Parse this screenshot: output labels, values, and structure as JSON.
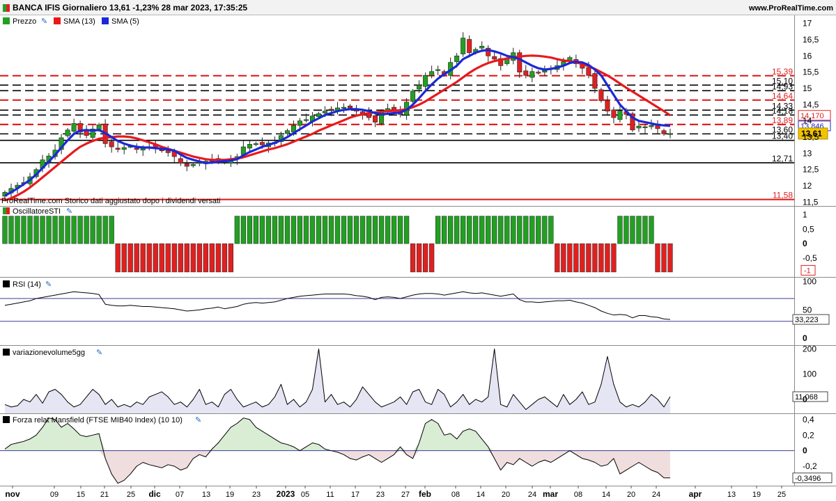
{
  "header": {
    "title": "BANCA IFIS Giornaliero 13,61 -1,23% 28 mar 2023, 17:35:25",
    "site": "www.ProRealTime.com",
    "note": "ProRealTime.com Storico dati aggiustato dopo i dividendi versati"
  },
  "colors": {
    "bull": "#22a022",
    "bear": "#e02020",
    "sma13": "#e8191c",
    "sma5": "#1a28d8",
    "panel_fill": "#e5e5f4",
    "pos_fill": "#d9ecd4",
    "neg_fill": "#f0dede"
  },
  "price_panel": {
    "legend": [
      "Prezzo",
      "SMA (13)",
      "SMA (5)"
    ],
    "yticks": [
      "17",
      "16,5",
      "16",
      "15,5",
      "15",
      "14,5",
      "14",
      "13,5",
      "13",
      "12,5",
      "12",
      "11,5"
    ],
    "levels": [
      {
        "value": "15,39",
        "num": 15.39,
        "color": "red",
        "style": "dashed"
      },
      {
        "value": "15,10",
        "num": 15.1,
        "color": "black",
        "style": "dashed"
      },
      {
        "value": "14,93",
        "num": 14.93,
        "color": "black",
        "style": "dashed"
      },
      {
        "value": "14,64",
        "num": 14.64,
        "color": "red",
        "style": "dashed"
      },
      {
        "value": "14,33",
        "num": 14.33,
        "color": "black",
        "style": "dashed"
      },
      {
        "value": "14,18",
        "num": 14.18,
        "color": "black",
        "style": "dashed"
      },
      {
        "value": "13,89",
        "num": 13.89,
        "color": "red",
        "style": "dashed"
      },
      {
        "value": "13,60",
        "num": 13.6,
        "color": "black",
        "style": "dashed"
      },
      {
        "value": "13,40",
        "num": 13.4,
        "color": "black",
        "style": "solid"
      },
      {
        "value": "12,71",
        "num": 12.71,
        "color": "black",
        "style": "solid"
      },
      {
        "value": "11,58",
        "num": 11.58,
        "color": "red",
        "style": "solid"
      }
    ],
    "tags": [
      {
        "value": "14,170",
        "num": 14.17,
        "color": "#e02020",
        "style": "box"
      },
      {
        "value": "13,846",
        "num": 13.846,
        "color": "#1a28d8",
        "style": "box"
      },
      {
        "value": "13,61",
        "num": 13.61,
        "color": "#000",
        "style": "gold"
      }
    ]
  },
  "sti_panel": {
    "title": "OscillatoreSTI",
    "yticks": [
      "1",
      "0,5",
      "0",
      "-0,5"
    ],
    "tag": "-1"
  },
  "rsi_panel": {
    "title": "RSI (14)",
    "yticks": [
      "100",
      "50",
      "0"
    ],
    "tag": "33,223"
  },
  "vol_panel": {
    "title": "variazionevolume5gg",
    "yticks": [
      "200",
      "100",
      "0"
    ],
    "tag": "11,068"
  },
  "mans_panel": {
    "title": "Forza relat Mansfield (FTSE MIB40 Index) (10 10)",
    "yticks": [
      "0,4",
      "0,2",
      "0",
      "-0,2"
    ],
    "tag": "-0,3496"
  },
  "xaxis": [
    {
      "label": "nov",
      "bold": true
    },
    {
      "label": "09"
    },
    {
      "label": "15"
    },
    {
      "label": "21"
    },
    {
      "label": "25"
    },
    {
      "label": "dic",
      "bold": true
    },
    {
      "label": "07"
    },
    {
      "label": "13"
    },
    {
      "label": "19"
    },
    {
      "label": "23"
    },
    {
      "label": "2023",
      "bold": true
    },
    {
      "label": "05"
    },
    {
      "label": "11"
    },
    {
      "label": "17"
    },
    {
      "label": "23"
    },
    {
      "label": "27"
    },
    {
      "label": "feb",
      "bold": true
    },
    {
      "label": "08"
    },
    {
      "label": "14"
    },
    {
      "label": "20"
    },
    {
      "label": "24"
    },
    {
      "label": "mar",
      "bold": true
    },
    {
      "label": "08"
    },
    {
      "label": "14"
    },
    {
      "label": "20"
    },
    {
      "label": "24"
    },
    {
      "label": "apr",
      "bold": true
    },
    {
      "label": "13"
    },
    {
      "label": "19"
    },
    {
      "label": "25"
    }
  ],
  "chart_data": {
    "type": "candlestick",
    "title": "BANCA IFIS Giornaliero",
    "x_dates": [
      "2022-10-28",
      "2022-10-31",
      "2022-11-01",
      "2022-11-02",
      "2022-11-03",
      "2022-11-04",
      "2022-11-07",
      "2022-11-08",
      "2022-11-09",
      "2022-11-10",
      "2022-11-11",
      "2022-11-14",
      "2022-11-15",
      "2022-11-16",
      "2022-11-17",
      "2022-11-18",
      "2022-11-21",
      "2022-11-22",
      "2022-11-23",
      "2022-11-24",
      "2022-11-25",
      "2022-11-28",
      "2022-11-29",
      "2022-11-30",
      "2022-12-01",
      "2022-12-02",
      "2022-12-05",
      "2022-12-06",
      "2022-12-07",
      "2022-12-08",
      "2022-12-09",
      "2022-12-12",
      "2022-12-13",
      "2022-12-14",
      "2022-12-15",
      "2022-12-16",
      "2022-12-19",
      "2022-12-20",
      "2022-12-21",
      "2022-12-22",
      "2022-12-23",
      "2022-12-27",
      "2022-12-28",
      "2022-12-29",
      "2022-12-30",
      "2023-01-02",
      "2023-01-03",
      "2023-01-04",
      "2023-01-05",
      "2023-01-06",
      "2023-01-09",
      "2023-01-10",
      "2023-01-11",
      "2023-01-12",
      "2023-01-13",
      "2023-01-16",
      "2023-01-17",
      "2023-01-18",
      "2023-01-19",
      "2023-01-20",
      "2023-01-23",
      "2023-01-24",
      "2023-01-25",
      "2023-01-26",
      "2023-01-27",
      "2023-01-30",
      "2023-01-31",
      "2023-02-01",
      "2023-02-02",
      "2023-02-03",
      "2023-02-06",
      "2023-02-07",
      "2023-02-08",
      "2023-02-09",
      "2023-02-10",
      "2023-02-13",
      "2023-02-14",
      "2023-02-15",
      "2023-02-16",
      "2023-02-17",
      "2023-02-20",
      "2023-02-21",
      "2023-02-22",
      "2023-02-23",
      "2023-02-24",
      "2023-02-27",
      "2023-02-28",
      "2023-03-01",
      "2023-03-02",
      "2023-03-03",
      "2023-03-06",
      "2023-03-07",
      "2023-03-08",
      "2023-03-09",
      "2023-03-10",
      "2023-03-13",
      "2023-03-14",
      "2023-03-15",
      "2023-03-16",
      "2023-03-17",
      "2023-03-20",
      "2023-03-21",
      "2023-03-22",
      "2023-03-23",
      "2023-03-24",
      "2023-03-27",
      "2023-03-28"
    ],
    "close": [
      11.8,
      11.92,
      12.02,
      12.1,
      12.28,
      12.5,
      12.8,
      12.92,
      13.1,
      13.48,
      13.72,
      13.92,
      13.65,
      13.55,
      13.75,
      13.88,
      13.3,
      13.2,
      13.12,
      13.18,
      13.22,
      13.12,
      13.16,
      13.2,
      13.15,
      13.08,
      13.02,
      12.9,
      12.7,
      12.6,
      12.66,
      12.72,
      12.76,
      12.8,
      12.82,
      12.72,
      12.8,
      12.9,
      13.2,
      13.28,
      13.3,
      13.26,
      13.32,
      13.34,
      13.55,
      13.7,
      13.86,
      14.0,
      14.04,
      14.15,
      14.22,
      14.3,
      14.33,
      14.4,
      14.42,
      14.4,
      14.3,
      14.22,
      14.1,
      13.96,
      14.3,
      14.38,
      14.34,
      14.2,
      14.58,
      14.92,
      15.1,
      15.4,
      15.52,
      15.58,
      15.42,
      15.8,
      16.0,
      16.55,
      16.1,
      16.2,
      16.3,
      16.0,
      15.9,
      15.7,
      15.9,
      16.1,
      15.5,
      15.4,
      15.52,
      15.48,
      15.55,
      15.62,
      15.7,
      15.82,
      15.95,
      15.76,
      15.62,
      15.4,
      15.0,
      14.62,
      14.3,
      14.1,
      14.3,
      14.2,
      13.72,
      13.84,
      13.82,
      13.86,
      13.76,
      13.6,
      13.61
    ],
    "sma13": [
      11.55,
      11.62,
      11.71,
      11.82,
      11.95,
      12.1,
      12.26,
      12.42,
      12.58,
      12.74,
      12.9,
      13.06,
      13.2,
      13.3,
      13.38,
      13.45,
      13.48,
      13.5,
      13.52,
      13.52,
      13.5,
      13.46,
      13.4,
      13.34,
      13.28,
      13.2,
      13.14,
      13.08,
      13.02,
      12.96,
      12.9,
      12.86,
      12.82,
      12.8,
      12.8,
      12.8,
      12.82,
      12.84,
      12.88,
      12.94,
      13.0,
      13.06,
      13.12,
      13.16,
      13.22,
      13.28,
      13.36,
      13.44,
      13.52,
      13.6,
      13.7,
      13.78,
      13.86,
      13.94,
      14.02,
      14.1,
      14.16,
      14.2,
      14.24,
      14.26,
      14.28,
      14.3,
      14.31,
      14.33,
      14.36,
      14.42,
      14.5,
      14.6,
      14.72,
      14.84,
      14.96,
      15.08,
      15.2,
      15.34,
      15.48,
      15.6,
      15.7,
      15.78,
      15.84,
      15.88,
      15.92,
      15.96,
      15.98,
      16.0,
      16.01,
      16.0,
      15.98,
      15.95,
      15.9,
      15.86,
      15.84,
      15.8,
      15.75,
      15.68,
      15.6,
      15.5,
      15.4,
      15.28,
      15.15,
      15.02,
      14.9,
      14.78,
      14.66,
      14.54,
      14.42,
      14.3,
      14.17
    ],
    "sma5": [
      11.7,
      11.8,
      11.92,
      12.05,
      12.18,
      12.35,
      12.55,
      12.75,
      12.95,
      13.18,
      13.4,
      13.6,
      13.7,
      13.72,
      13.7,
      13.72,
      13.62,
      13.5,
      13.38,
      13.3,
      13.24,
      13.2,
      13.18,
      13.18,
      13.16,
      13.14,
      13.12,
      13.08,
      12.96,
      12.86,
      12.8,
      12.75,
      12.7,
      12.72,
      12.74,
      12.76,
      12.78,
      12.82,
      12.94,
      13.04,
      13.12,
      13.2,
      13.26,
      13.32,
      13.4,
      13.5,
      13.62,
      13.74,
      13.86,
      13.98,
      14.08,
      14.18,
      14.24,
      14.3,
      14.34,
      14.36,
      14.36,
      14.34,
      14.3,
      14.24,
      14.2,
      14.22,
      14.24,
      14.26,
      14.34,
      14.5,
      14.7,
      14.92,
      15.12,
      15.3,
      15.44,
      15.56,
      15.7,
      15.9,
      16.0,
      16.1,
      16.16,
      16.18,
      16.14,
      16.08,
      16.0,
      15.96,
      15.9,
      15.8,
      15.7,
      15.62,
      15.58,
      15.6,
      15.64,
      15.7,
      15.78,
      15.82,
      15.8,
      15.72,
      15.58,
      15.4,
      15.1,
      14.8,
      14.5,
      14.3,
      14.1,
      14.0,
      13.96,
      13.92,
      13.88,
      13.86,
      13.846
    ],
    "sti": [
      1,
      1,
      1,
      1,
      1,
      1,
      1,
      1,
      1,
      1,
      1,
      1,
      1,
      1,
      1,
      1,
      1,
      1,
      -1,
      -1,
      -1,
      -1,
      -1,
      -1,
      -1,
      -1,
      -1,
      -1,
      -1,
      -1,
      -1,
      -1,
      -1,
      -1,
      -1,
      -1,
      -1,
      1,
      1,
      1,
      1,
      1,
      1,
      1,
      1,
      1,
      1,
      1,
      1,
      1,
      1,
      1,
      1,
      1,
      1,
      1,
      1,
      1,
      1,
      1,
      1,
      1,
      1,
      1,
      1,
      -1,
      -1,
      -1,
      -1,
      1,
      1,
      1,
      1,
      1,
      1,
      1,
      1,
      1,
      1,
      1,
      1,
      1,
      1,
      1,
      1,
      1,
      1,
      1,
      -1,
      -1,
      -1,
      -1,
      -1,
      -1,
      -1,
      -1,
      -1,
      -1,
      1,
      1,
      1,
      1,
      1,
      1,
      -1,
      -1,
      -1,
      -1,
      -1,
      -1,
      -1,
      -1,
      -1,
      -1,
      -1,
      -1,
      -1,
      -1,
      -1,
      -1
    ],
    "rsi": [
      58,
      60,
      62,
      64,
      66,
      70,
      72,
      74,
      76,
      78,
      80,
      82,
      81,
      80,
      79,
      77,
      60,
      58,
      57,
      57,
      58,
      57,
      56,
      56,
      55,
      54,
      53,
      52,
      50,
      48,
      49,
      50,
      52,
      53,
      55,
      52,
      54,
      56,
      60,
      62,
      63,
      62,
      63,
      64,
      67,
      70,
      72,
      74,
      75,
      76,
      77,
      78,
      78,
      78,
      78,
      77,
      75,
      74,
      72,
      68,
      72,
      73,
      72,
      70,
      73,
      76,
      78,
      79,
      79,
      78,
      76,
      78,
      80,
      82,
      80,
      79,
      80,
      78,
      76,
      74,
      76,
      78,
      68,
      64,
      64,
      63,
      64,
      65,
      66,
      66,
      67,
      64,
      62,
      58,
      54,
      48,
      44,
      41,
      42,
      41,
      36,
      40,
      40,
      38,
      37,
      34,
      33.223
    ],
    "rsi_levels": [
      70,
      30
    ],
    "volume_var": [
      -20,
      -30,
      -25,
      0,
      -10,
      20,
      -15,
      30,
      40,
      20,
      -10,
      -30,
      -20,
      10,
      40,
      20,
      -20,
      0,
      -30,
      -20,
      -30,
      -10,
      -20,
      10,
      20,
      30,
      10,
      -20,
      -10,
      -30,
      0,
      40,
      -20,
      -10,
      -30,
      20,
      40,
      0,
      -30,
      -20,
      -10,
      -30,
      -20,
      10,
      60,
      -20,
      0,
      -30,
      -10,
      40,
      200,
      -10,
      20,
      -20,
      -10,
      -30,
      0,
      50,
      20,
      -10,
      -30,
      -20,
      -10,
      10,
      -20,
      30,
      40,
      -10,
      -20,
      40,
      20,
      -30,
      -10,
      20,
      -20,
      0,
      -10,
      10,
      200,
      -20,
      -30,
      20,
      -10,
      -40,
      -20,
      0,
      10,
      -10,
      -30,
      20,
      -20,
      0,
      30,
      -20,
      -10,
      60,
      170,
      60,
      -10,
      -30,
      -20,
      -30,
      -10,
      20,
      0,
      -30,
      11.068
    ],
    "mansfield": [
      0.02,
      0.08,
      0.1,
      0.12,
      0.15,
      0.2,
      0.3,
      0.42,
      0.4,
      0.3,
      0.35,
      0.28,
      0.2,
      0.18,
      0.2,
      0.22,
      -0.1,
      -0.3,
      -0.42,
      -0.38,
      -0.3,
      -0.2,
      -0.15,
      -0.18,
      -0.2,
      -0.22,
      -0.18,
      -0.2,
      -0.25,
      -0.22,
      -0.1,
      -0.05,
      -0.08,
      0.02,
      0.1,
      0.2,
      0.3,
      0.35,
      0.42,
      0.4,
      0.3,
      0.25,
      0.2,
      0.15,
      0.1,
      0.08,
      0.05,
      0.0,
      0.05,
      0.1,
      0.08,
      0.02,
      0.0,
      -0.02,
      -0.05,
      -0.1,
      -0.12,
      -0.08,
      -0.05,
      -0.1,
      -0.15,
      -0.1,
      -0.05,
      0.05,
      -0.05,
      -0.1,
      0.1,
      0.35,
      0.4,
      0.35,
      0.2,
      0.22,
      0.15,
      0.25,
      0.28,
      0.25,
      0.15,
      0.05,
      -0.1,
      -0.25,
      -0.15,
      -0.18,
      -0.1,
      -0.15,
      -0.2,
      -0.15,
      -0.12,
      -0.15,
      -0.1,
      -0.05,
      0.0,
      -0.05,
      -0.1,
      -0.12,
      -0.15,
      -0.2,
      -0.18,
      -0.1,
      -0.3,
      -0.25,
      -0.2,
      -0.15,
      -0.2,
      -0.25,
      -0.28,
      -0.3496,
      -0.3496
    ],
    "ylim_price": [
      11.5,
      17.2
    ]
  }
}
